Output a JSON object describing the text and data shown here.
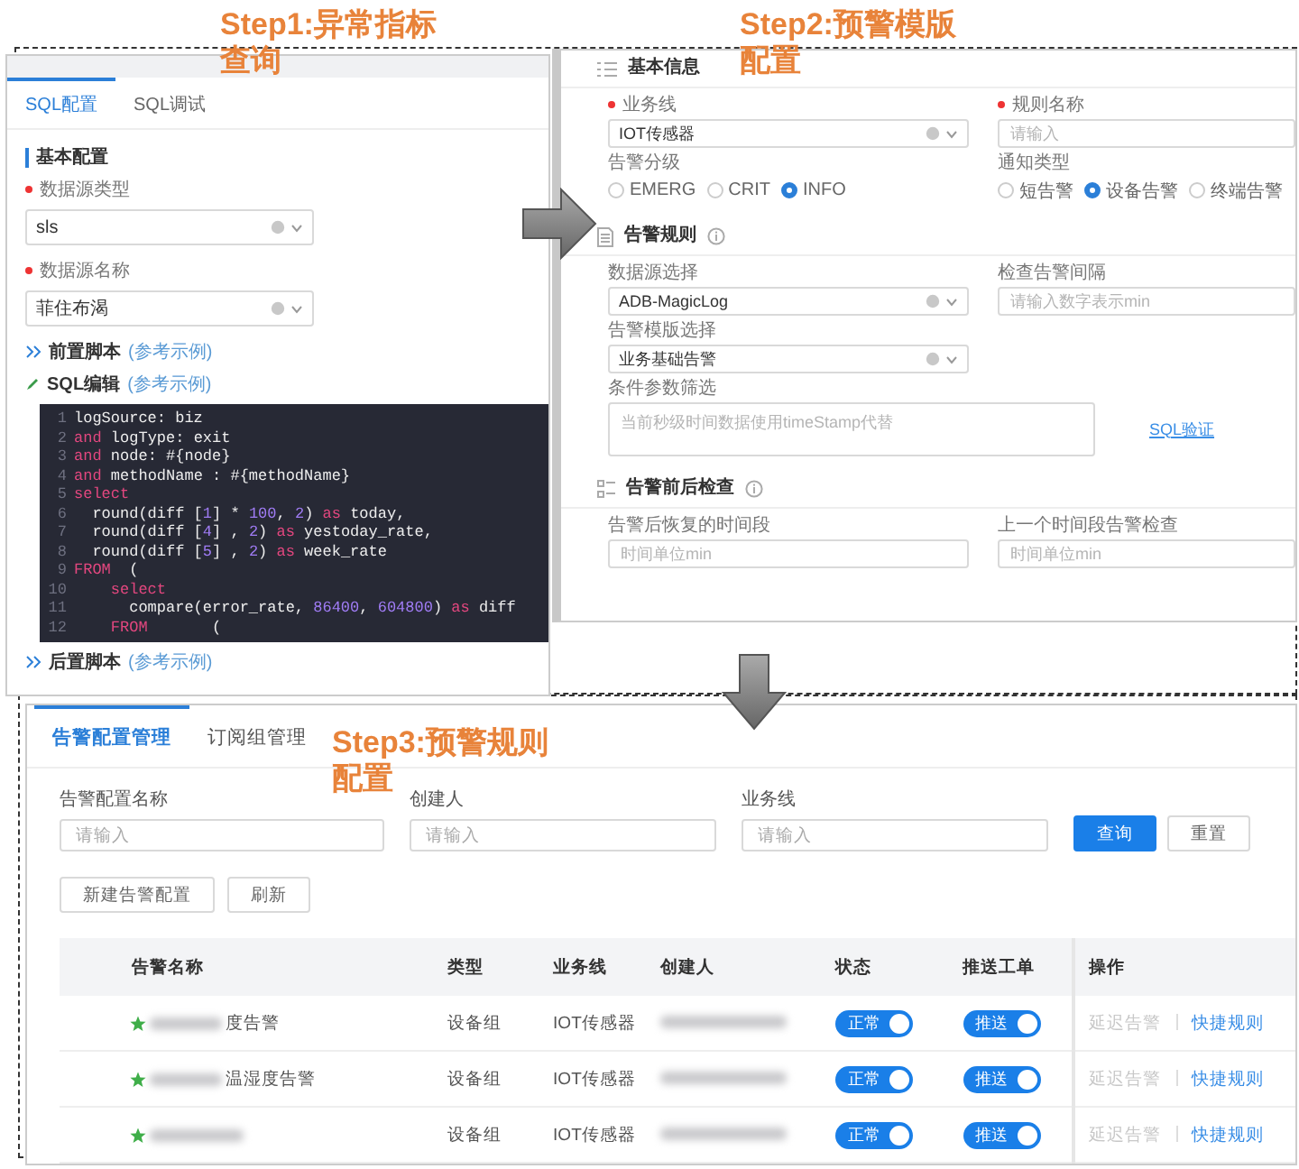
{
  "steps": [
    {
      "lines": [
        "Step1:异常指标",
        "查询"
      ]
    },
    {
      "lines": [
        "Step2:预警模版",
        "配置"
      ]
    },
    {
      "lines": [
        "Step3:预警规则",
        "配置"
      ]
    }
  ],
  "sql_config": {
    "tabs": [
      {
        "label": "SQL配置",
        "selected": true
      },
      {
        "label": "SQL调试",
        "selected": false
      }
    ],
    "section": "基本配置",
    "fields": [
      {
        "label": "数据源类型",
        "required": true,
        "value": "sls"
      },
      {
        "label": "数据源名称",
        "required": true,
        "value": "菲住布渴"
      }
    ],
    "pre_script": {
      "title": "前置脚本",
      "link": "(参考示例)"
    },
    "sql_editor": {
      "title": "SQL编辑",
      "link": "(参考示例)",
      "lines": [
        {
          "number": "1",
          "tokens": [
            {
              "kind": "plain",
              "text": "logSource: biz"
            }
          ]
        },
        {
          "number": "2",
          "tokens": [
            {
              "kind": "kw",
              "text": "and"
            },
            {
              "kind": "plain",
              "text": " logType: exit"
            }
          ]
        },
        {
          "number": "3",
          "tokens": [
            {
              "kind": "kw",
              "text": "and"
            },
            {
              "kind": "plain",
              "text": " node: #{node}"
            }
          ]
        },
        {
          "number": "4",
          "tokens": [
            {
              "kind": "kw",
              "text": "and"
            },
            {
              "kind": "plain",
              "text": " methodName : #{methodName}"
            }
          ]
        },
        {
          "number": "5",
          "tokens": [
            {
              "kind": "kw",
              "text": "select"
            }
          ]
        },
        {
          "number": "6",
          "tokens": [
            {
              "kind": "plain",
              "text": "  round(diff ["
            },
            {
              "kind": "num",
              "text": "1"
            },
            {
              "kind": "plain",
              "text": "] * "
            },
            {
              "kind": "num",
              "text": "100"
            },
            {
              "kind": "plain",
              "text": ", "
            },
            {
              "kind": "num",
              "text": "2"
            },
            {
              "kind": "plain",
              "text": ") "
            },
            {
              "kind": "kw",
              "text": "as"
            },
            {
              "kind": "plain",
              "text": " today,"
            }
          ]
        },
        {
          "number": "7",
          "tokens": [
            {
              "kind": "plain",
              "text": "  round(diff ["
            },
            {
              "kind": "num",
              "text": "4"
            },
            {
              "kind": "plain",
              "text": "] , "
            },
            {
              "kind": "num",
              "text": "2"
            },
            {
              "kind": "plain",
              "text": ") "
            },
            {
              "kind": "kw",
              "text": "as"
            },
            {
              "kind": "plain",
              "text": " yestoday_rate,"
            }
          ]
        },
        {
          "number": "8",
          "tokens": [
            {
              "kind": "plain",
              "text": "  round(diff ["
            },
            {
              "kind": "num",
              "text": "5"
            },
            {
              "kind": "plain",
              "text": "] , "
            },
            {
              "kind": "num",
              "text": "2"
            },
            {
              "kind": "plain",
              "text": ") "
            },
            {
              "kind": "kw",
              "text": "as"
            },
            {
              "kind": "plain",
              "text": " week_rate"
            }
          ]
        },
        {
          "number": "9",
          "tokens": [
            {
              "kind": "kw",
              "text": "FROM"
            },
            {
              "kind": "plain",
              "text": "  ("
            }
          ]
        },
        {
          "number": "10",
          "tokens": [
            {
              "kind": "kw",
              "text": "    select"
            }
          ]
        },
        {
          "number": "11",
          "tokens": [
            {
              "kind": "plain",
              "text": "      compare(error_rate, "
            },
            {
              "kind": "num",
              "text": "86400"
            },
            {
              "kind": "plain",
              "text": ", "
            },
            {
              "kind": "num",
              "text": "604800"
            },
            {
              "kind": "plain",
              "text": ") "
            },
            {
              "kind": "kw",
              "text": "as"
            },
            {
              "kind": "plain",
              "text": " diff"
            }
          ]
        },
        {
          "number": "12",
          "tokens": [
            {
              "kind": "kw",
              "text": "    FROM"
            },
            {
              "kind": "plain",
              "text": "       ("
            }
          ]
        }
      ]
    },
    "post_script": {
      "title": "后置脚本",
      "link": "(参考示例)"
    }
  },
  "template_config": {
    "sections": [
      {
        "title": "基本信息",
        "info": false,
        "rows": [
          [
            {
              "kind": "select",
              "label": "业务线",
              "required": true,
              "value": "IOT传感器"
            },
            {
              "kind": "input",
              "label": "规则名称",
              "required": true,
              "placeholder": "请输入"
            }
          ],
          [
            {
              "kind": "radio",
              "label": "告警分级",
              "options": [
                {
                  "label": "EMERG",
                  "selected": false
                },
                {
                  "label": "CRIT",
                  "selected": false
                },
                {
                  "label": "INFO",
                  "selected": true
                }
              ]
            },
            {
              "kind": "radio",
              "label": "通知类型",
              "options": [
                {
                  "label": "短告警",
                  "selected": false
                },
                {
                  "label": "设备告警",
                  "selected": true
                },
                {
                  "label": "终端告警",
                  "selected": false
                }
              ]
            }
          ]
        ]
      },
      {
        "title": "告警规则",
        "info": true,
        "rows": [
          [
            {
              "kind": "select",
              "label": "数据源选择",
              "required": false,
              "value": "ADB-MagicLog"
            },
            {
              "kind": "input",
              "label": "检查告警间隔",
              "required": false,
              "placeholder": "请输入数字表示min"
            }
          ],
          [
            {
              "kind": "select",
              "label": "告警模版选择",
              "required": false,
              "value": "业务基础告警"
            }
          ],
          [
            {
              "kind": "textarea",
              "label": "条件参数筛选",
              "placeholder": "当前秒级时间数据使用timeStamp代替",
              "link": "SQL验证"
            }
          ]
        ]
      },
      {
        "title": "告警前后检查",
        "info": true,
        "rows": [
          [
            {
              "kind": "input",
              "label": "告警后恢复的时间段",
              "required": false,
              "placeholder": "时间单位min"
            },
            {
              "kind": "input",
              "label": "上一个时间段告警检查",
              "required": false,
              "placeholder": "时间单位min"
            }
          ]
        ]
      }
    ]
  },
  "rules_config": {
    "tabs": [
      {
        "label": "告警配置管理",
        "selected": true
      },
      {
        "label": "订阅组管理",
        "selected": false
      }
    ],
    "filters": [
      {
        "label": "告警配置名称",
        "placeholder": "请输入"
      },
      {
        "label": "创建人",
        "placeholder": "请输入"
      },
      {
        "label": "业务线",
        "placeholder": "请输入"
      }
    ],
    "query_buttons": [
      {
        "label": "查询",
        "primary": true
      },
      {
        "label": "重置",
        "primary": false
      }
    ],
    "actions": [
      "新建告警配置",
      "刷新"
    ],
    "columns": [
      "告警名称",
      "类型",
      "业务线",
      "创建人",
      "状态",
      "推送工单",
      "操作"
    ],
    "rows": [
      {
        "name": "度告警",
        "type": "设备组",
        "line": "IOT传感器",
        "status": {
          "label": "正常",
          "on": true
        },
        "push": {
          "label": "推送",
          "on": true
        },
        "actions": [
          {
            "label": "延迟告警",
            "disabled": true
          },
          {
            "label": "快捷规则",
            "disabled": false
          }
        ]
      },
      {
        "name": "温湿度告警",
        "type": "设备组",
        "line": "IOT传感器",
        "status": {
          "label": "正常",
          "on": true
        },
        "push": {
          "label": "推送",
          "on": true
        },
        "actions": [
          {
            "label": "延迟告警",
            "disabled": true
          },
          {
            "label": "快捷规则",
            "disabled": false
          }
        ]
      },
      {
        "type": "设备组",
        "line": "IOT传感器",
        "status": {
          "label": "正常",
          "on": true
        },
        "push": {
          "label": "推送",
          "on": true
        },
        "actions": [
          {
            "label": "延迟告警",
            "disabled": true
          },
          {
            "label": "快捷规则",
            "disabled": false
          }
        ]
      }
    ]
  }
}
